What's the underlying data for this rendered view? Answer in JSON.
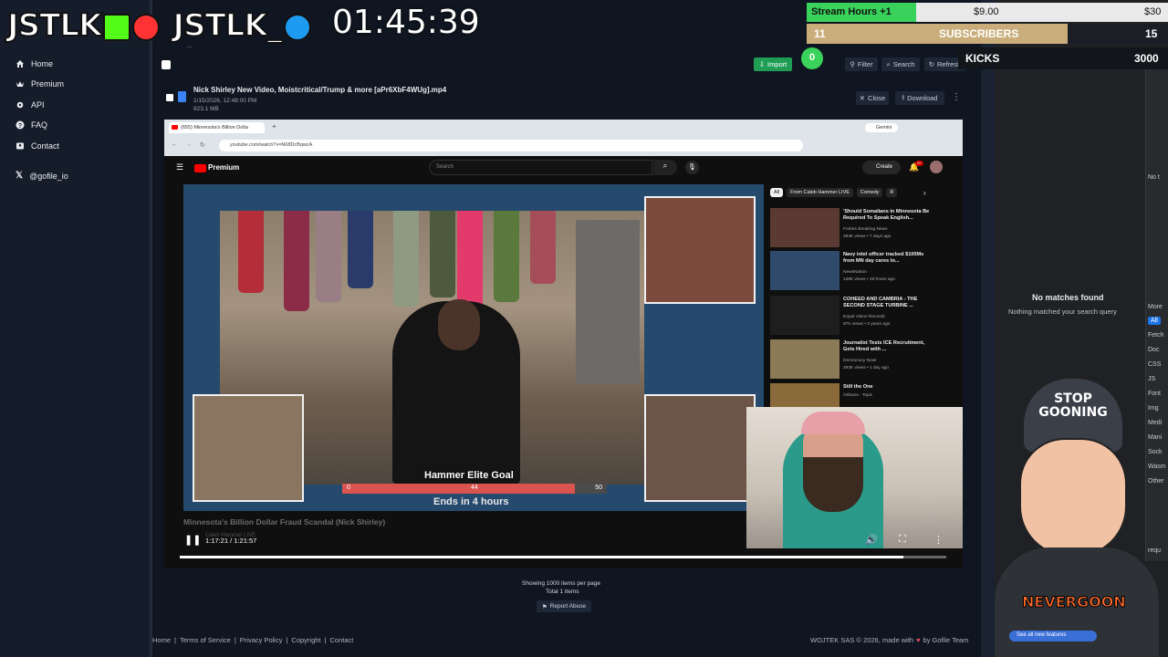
{
  "overlay": {
    "logo_left": "JSTLK",
    "logo_right": "JSTLK_",
    "timer": "01:45:39",
    "goals": {
      "stream_hours_label": "Stream Hours +1",
      "amount": "$9.00",
      "amount_target": "$30",
      "subs_count": "11",
      "subs_label": "SUBSCRIBERS",
      "subs_target": "15",
      "kicks_badge": "0",
      "kicks_label": "KICKS",
      "kicks_target": "3000"
    },
    "mascot_text": "STOP\nGOONING",
    "shirt_text": "NEVERGOON",
    "see_all": "See all new features"
  },
  "sidebar": {
    "items": [
      {
        "label": "Home",
        "icon": "home-icon"
      },
      {
        "label": "Premium",
        "icon": "crown-icon"
      },
      {
        "label": "API",
        "icon": "gear-icon"
      },
      {
        "label": "FAQ",
        "icon": "question-icon"
      },
      {
        "label": "Contact",
        "icon": "contact-icon"
      }
    ],
    "social": "@gofile_io"
  },
  "toolbar": {
    "import": "Import",
    "filter": "Filter",
    "search": "Search",
    "refresh": "Refresh",
    "more": "..."
  },
  "file": {
    "name": "Nick Shirley New Video, Moistcritical/Trump & more [aPr6XbF4WUg].mp4",
    "date": "1/15/2026, 12:48:00 PM",
    "size": "823.1 MB",
    "close": "Close",
    "download": "Download"
  },
  "browser": {
    "tab_title": "(655) Minnesota's Billion Dolla",
    "url": "youtube.com/watch?v=N68DcBqwcA",
    "gemini": "Gemini"
  },
  "youtube": {
    "brand": "Premium",
    "search_placeholder": "Search",
    "create": "Create",
    "notif_count": "9+",
    "chips": [
      "All",
      "From Caleb Hammer LIVE",
      "Comedy",
      "R"
    ],
    "video_title": "Minnesota's Billion Dollar Fraud Scandal (Nick Shirley)",
    "channel": "Caleb Hammer LIVE",
    "time": "1:17:21 / 1:21:57",
    "goal_title": "Hammer Elite Goal",
    "goal_min": "0",
    "goal_current": "44",
    "goal_max": "50",
    "goal_progress": 0.88,
    "goal_ends": "Ends in 4 hours",
    "playback_progress": 0.944,
    "related": [
      {
        "title": "'Should Somalians in Minnesota Be Required To Speak English...",
        "channel": "Forbes Breaking News",
        "meta": "284K views • 7 days ago",
        "duration": "6:58"
      },
      {
        "title": "Navy intel officer tracked $100Ms from MN day cares to...",
        "channel": "NewsNation",
        "meta": "138K views • 19 hours ago",
        "duration": "4:39",
        "badge": "New"
      },
      {
        "title": "COHEED AND CAMBRIA - THE SECOND STAGE TURBINE ...",
        "channel": "Equal Vision Records",
        "meta": "87K views • 3 years ago",
        "duration": "5:42"
      },
      {
        "title": "Journalist Tests ICE Recruitment, Gets Hired with ...",
        "channel": "Democracy Now!",
        "meta": "293K views • 1 day ago",
        "duration": "8:04",
        "badge": "New"
      },
      {
        "title": "Still the One",
        "channel": "Orleans - Topic",
        "meta": "7.6M views • 5 years ago",
        "duration": ""
      }
    ]
  },
  "pagination": {
    "showing": "Showing 1000 items per page",
    "total": "Total 1 items",
    "report": "Report Abuse"
  },
  "devtools": {
    "no_matches": "No matches found",
    "no_matches_sub": "Nothing matched your search query",
    "tabs": [
      "All",
      "Fetch",
      "Doc",
      "CSS",
      "JS",
      "Font",
      "Img",
      "Medi",
      "Mani",
      "Sock",
      "Wasm",
      "Other"
    ],
    "no_throttle": "No t",
    "more": "More",
    "requests": "requ"
  },
  "footer": {
    "links": [
      "Home",
      "Terms of Service",
      "Privacy Policy",
      "Copyright",
      "Contact"
    ],
    "credit_prefix": "WOJTEK SAS © 2026, made with",
    "credit_suffix": "by Gofile Team"
  },
  "colors": {
    "import_green": "#1f9d55",
    "goal_green": "#39d25a",
    "goal_gold": "#c9ae7b",
    "goal_bar_red": "#d9534f",
    "yt_red": "#ff0000"
  }
}
